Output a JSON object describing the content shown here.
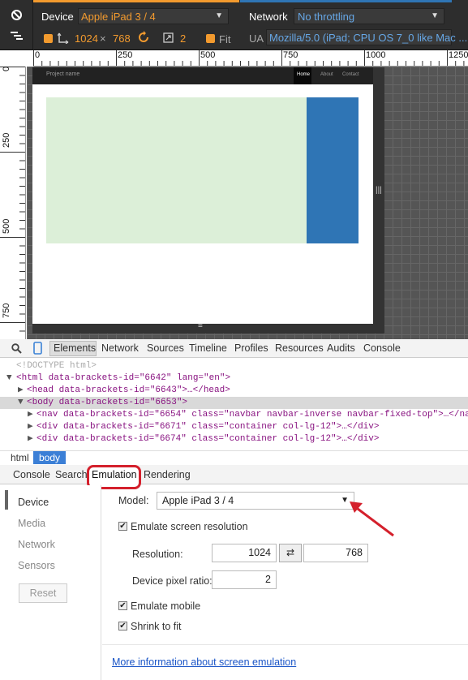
{
  "toolbar": {
    "device_label": "Device",
    "device_value": "Apple iPad 3 / 4",
    "width": "1024",
    "times": "×",
    "height": "768",
    "pixel_ratio": "2",
    "fit_label": "Fit",
    "network_label": "Network",
    "network_value": "No throttling",
    "ua_label": "UA",
    "ua_value": "Mozilla/5.0 (iPad; CPU OS 7_0 like Mac ..."
  },
  "ruler": {
    "h_ticks": [
      "0",
      "250",
      "500",
      "750",
      "1000",
      "1250"
    ],
    "v_ticks": [
      "0",
      "250",
      "500",
      "750"
    ]
  },
  "preview": {
    "brand": "Project name",
    "nav": [
      "Home",
      "About",
      "Contact"
    ]
  },
  "devtools": {
    "tabs": [
      "Elements",
      "Network",
      "Sources",
      "Timeline",
      "Profiles",
      "Resources",
      "Audits",
      "Console"
    ],
    "dom": {
      "doctype": "<!DOCTYPE html>",
      "html_open": "<html data-brackets-id=\"6642\" lang=\"en\">",
      "head": "<head data-brackets-id=\"6643\">…</head>",
      "body_open": "<body data-brackets-id=\"6653\">",
      "nav": "<nav data-brackets-id=\"6654\" class=\"navbar navbar-inverse navbar-fixed-top\">…</na",
      "div1": "<div data-brackets-id=\"6671\" class=\"container col-lg-12\">…</div>",
      "div2": "<div data-brackets-id=\"6674\" class=\"container col-lg-12\">…</div>"
    },
    "crumbs": [
      "html",
      "body"
    ],
    "drawer_tabs": [
      "Console",
      "Search",
      "Emulation",
      "Rendering"
    ],
    "side": [
      "Device",
      "Media",
      "Network",
      "Sensors"
    ],
    "reset": "Reset",
    "emulation": {
      "model_label": "Model:",
      "model_value": "Apple iPad 3 / 4",
      "emulate_resolution": "Emulate screen resolution",
      "resolution_label": "Resolution:",
      "res_w": "1024",
      "res_swap": "⇄",
      "res_h": "768",
      "dpr_label": "Device pixel ratio:",
      "dpr_value": "2",
      "emulate_mobile": "Emulate mobile",
      "shrink": "Shrink to fit",
      "more_link": "More information about screen emulation"
    }
  },
  "colors": {
    "accent_orange": "#f29a2e",
    "link_blue": "#66a7e6",
    "annotation_red": "#d4202c"
  }
}
